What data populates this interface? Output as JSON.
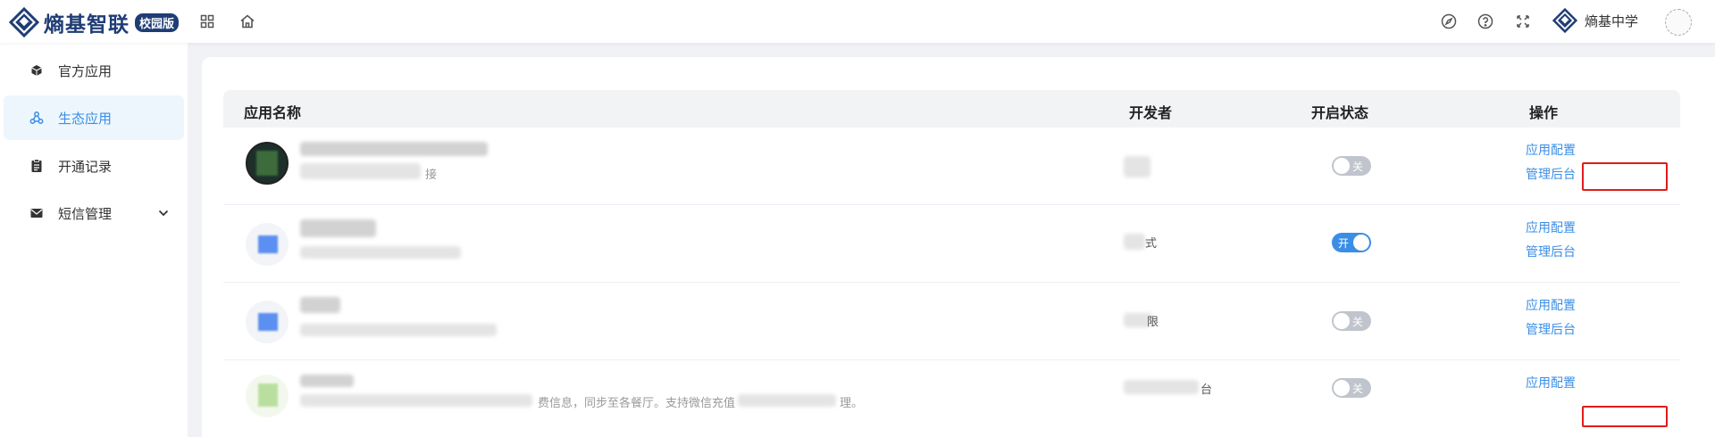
{
  "brand": {
    "name": "熵基智联",
    "badge": "校园版",
    "color": "#1f3d75"
  },
  "topbar": {
    "icons": [
      "grid-icon",
      "home-icon",
      "compass-icon",
      "help-icon",
      "fullscreen-icon"
    ],
    "school_name": "熵基中学"
  },
  "sidebar": {
    "items": [
      {
        "label": "官方应用",
        "icon": "cube-icon"
      },
      {
        "label": "生态应用",
        "icon": "ecosystem-icon",
        "active": true
      },
      {
        "label": "开通记录",
        "icon": "clipboard-icon"
      },
      {
        "label": "短信管理",
        "icon": "mail-icon",
        "expandable": true
      }
    ]
  },
  "table": {
    "headers": {
      "name": "应用名称",
      "developer": "开发者",
      "status": "开启状态",
      "actions": "操作"
    },
    "rows": [
      {
        "desc_fragment": "接",
        "developer_fragment": "",
        "status": false,
        "status_text": "关",
        "actions": [
          "应用配置",
          "管理后台"
        ]
      },
      {
        "desc_fragment": "",
        "developer_fragment": "式",
        "status": true,
        "status_text": "开",
        "actions": [
          "应用配置",
          "管理后台"
        ]
      },
      {
        "desc_fragment": "",
        "developer_fragment": "限",
        "status": false,
        "status_text": "关",
        "actions": [
          "应用配置",
          "管理后台"
        ]
      },
      {
        "desc_fragment": "费信息，同步至各餐厅。支持微信充值",
        "desc_fragment_2": "理。",
        "developer_fragment": "台",
        "status": false,
        "status_text": "关",
        "actions": [
          "应用配置"
        ]
      }
    ]
  },
  "colors": {
    "accent": "#3a8ee6",
    "highlight_box": "#e11b1b",
    "switch_off": "#c0c4cc"
  }
}
